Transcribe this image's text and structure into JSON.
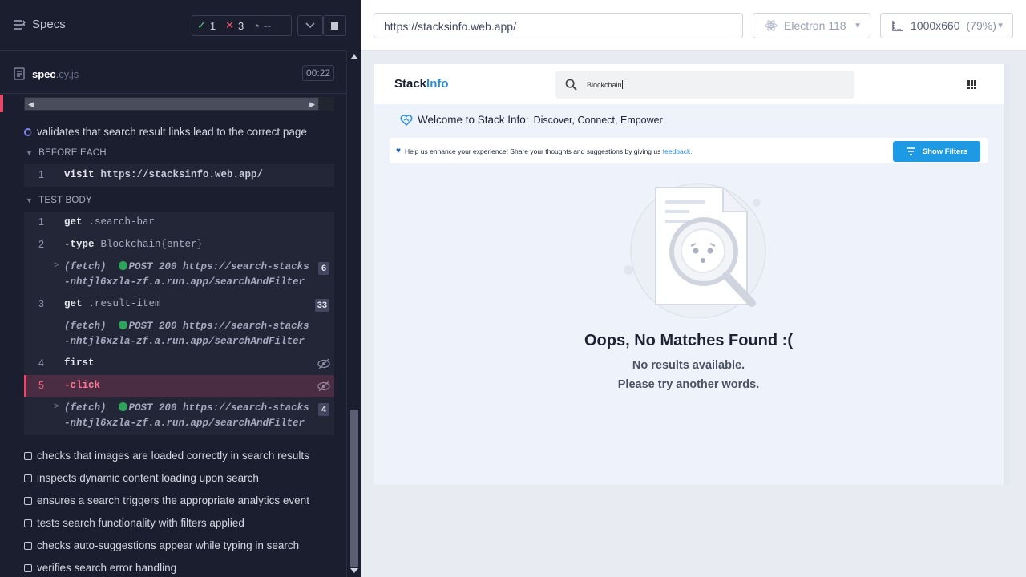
{
  "runner": {
    "specs_label": "Specs",
    "stats": {
      "passed": "1",
      "failed": "3",
      "pending": "--"
    },
    "spec_file": {
      "name": "spec",
      "ext": ".cy.js",
      "duration": "00:22"
    },
    "active_test": "validates that search result links lead to the correct page",
    "before_each_label": "BEFORE EACH",
    "test_body_label": "TEST BODY",
    "before_each": [
      {
        "num": "1",
        "cmd": "visit",
        "arg": "https://stacksinfo.web.app/"
      }
    ],
    "commands": [
      {
        "num": "1",
        "cmd": "get",
        "arg": ".search-bar"
      },
      {
        "num": "2",
        "cmd": "-type",
        "arg": "Blockchain{enter}"
      },
      {
        "fetch": "(fetch)",
        "request": "POST 200 https://search-stacks-nhtjl6xzla-zf.a.run.app/searchAndFilter",
        "count": "6"
      },
      {
        "num": "3",
        "cmd": "get",
        "arg": ".result-item",
        "count": "33"
      },
      {
        "fetch": "(fetch)",
        "request": "POST 200 https://search-stacks-nhtjl6xzla-zf.a.run.app/searchAndFilter"
      },
      {
        "num": "4",
        "cmd": "first"
      },
      {
        "num": "5",
        "cmd": "-click"
      },
      {
        "fetch": "(fetch)",
        "request": "POST 200 https://search-stacks-nhtjl6xzla-zf.a.run.app/searchAndFilter",
        "count": "4"
      }
    ],
    "other_tests": [
      "checks that images are loaded correctly in search results",
      "inspects dynamic content loading upon search",
      "ensures a search triggers the appropriate analytics event",
      "tests search functionality with filters applied",
      "checks auto-suggestions appear while typing in search",
      "verifies search error handling"
    ]
  },
  "aut": {
    "url": "https://stacksinfo.web.app/",
    "browser": "Electron 118",
    "viewport": "1000x660",
    "zoom": "(79%)"
  },
  "site": {
    "logo_a": "Stack",
    "logo_b": "Info",
    "search_value": "Blockchain",
    "welcome": "Welcome to Stack Info:",
    "welcome_sub": "Discover, Connect, Empower",
    "feedback_msg": "Help us enhance your experience! Share your thoughts and suggestions by giving us",
    "feedback_link": "feedback.",
    "filters_btn": "Show Filters",
    "empty_title": "Oops, No Matches Found :(",
    "empty_line1": "No results available.",
    "empty_line2": "Please try another words."
  },
  "colors": {
    "fail": "#e8476a",
    "pass": "#5fd08a",
    "accent": "#1e9ae5",
    "runner_bg": "#1b1e2e"
  }
}
